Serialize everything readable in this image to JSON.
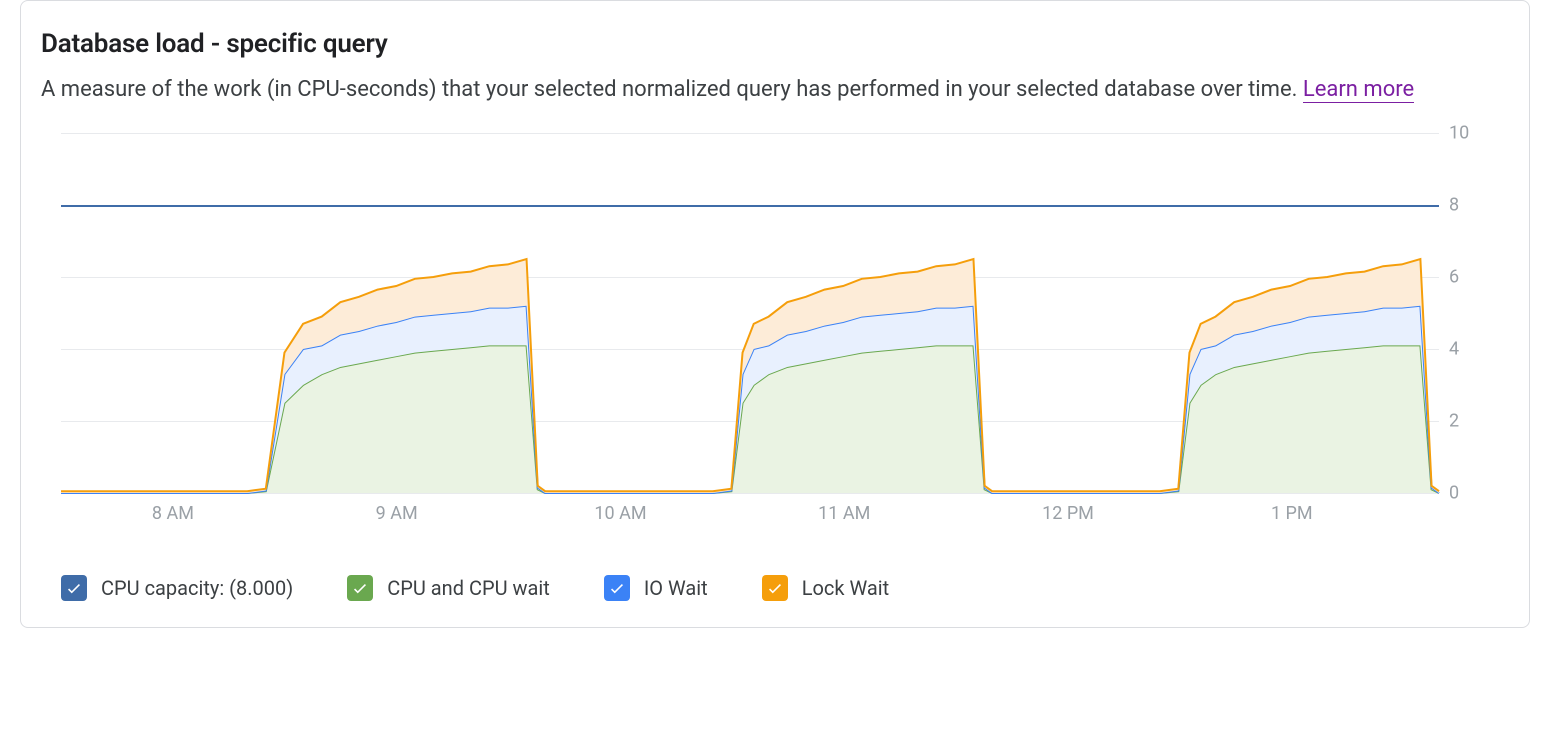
{
  "title": "Database load - specific query",
  "subtitle": "A measure of the work (in CPU-seconds) that your selected normalized query has performed in your selected database over time. ",
  "learn_more": "Learn more",
  "legend": {
    "cpu_capacity": "CPU capacity: (8.000)",
    "cpu_wait": "CPU and CPU wait",
    "io_wait": "IO Wait",
    "lock_wait": "Lock Wait"
  },
  "colors": {
    "cpu_capacity": "#3f6ca8",
    "cpu_wait": "#6aa84f",
    "io_wait": "#3b82f6",
    "lock_wait": "#f59e0b",
    "cpu_wait_fill": "#eaf3e3",
    "io_wait_fill": "#e8f0fe",
    "lock_wait_fill": "#fdecd8"
  },
  "chart_data": {
    "type": "area",
    "title": "Database load - specific query",
    "xlabel": "",
    "ylabel": "",
    "ylim": [
      0,
      10
    ],
    "y_ticks": [
      0,
      2,
      4,
      6,
      8,
      10
    ],
    "x_ticks": [
      "8 AM",
      "9 AM",
      "10 AM",
      "11 AM",
      "12 PM",
      "1 PM"
    ],
    "x_range_minutes": [
      450,
      820
    ],
    "cpu_capacity_value": 8.0,
    "x_minutes": [
      450,
      460,
      470,
      480,
      490,
      500,
      505,
      510,
      515,
      520,
      525,
      530,
      535,
      540,
      545,
      550,
      555,
      560,
      565,
      570,
      575,
      578,
      580,
      585,
      590,
      600,
      610,
      620,
      625,
      630,
      633,
      636,
      640,
      645,
      650,
      655,
      660,
      665,
      670,
      675,
      680,
      685,
      690,
      695,
      698,
      700,
      705,
      710,
      720,
      730,
      740,
      745,
      750,
      753,
      756,
      760,
      765,
      770,
      775,
      780,
      785,
      790,
      795,
      800,
      805,
      810,
      815,
      818,
      820
    ],
    "series": [
      {
        "name": "CPU and CPU wait",
        "color_key": "cpu_wait",
        "values": [
          0,
          0,
          0,
          0,
          0,
          0,
          0.05,
          2.5,
          3.0,
          3.3,
          3.5,
          3.6,
          3.7,
          3.8,
          3.9,
          3.95,
          4.0,
          4.05,
          4.1,
          4.1,
          4.1,
          0.1,
          0,
          0,
          0,
          0,
          0,
          0,
          0,
          0.05,
          2.5,
          3.0,
          3.3,
          3.5,
          3.6,
          3.7,
          3.8,
          3.9,
          3.95,
          4.0,
          4.05,
          4.1,
          4.1,
          4.1,
          0.1,
          0,
          0,
          0,
          0,
          0,
          0,
          0,
          0.05,
          2.5,
          3.0,
          3.3,
          3.5,
          3.6,
          3.7,
          3.8,
          3.9,
          3.95,
          4.0,
          4.05,
          4.1,
          4.1,
          4.1,
          0.1,
          0
        ]
      },
      {
        "name": "IO Wait",
        "color_key": "io_wait",
        "values": [
          0,
          0,
          0,
          0,
          0,
          0,
          0.02,
          0.8,
          1.0,
          0.8,
          0.9,
          0.9,
          0.95,
          0.95,
          1.0,
          1.0,
          1.0,
          1.0,
          1.05,
          1.05,
          1.1,
          0.05,
          0,
          0,
          0,
          0,
          0,
          0,
          0,
          0.02,
          0.8,
          1.0,
          0.8,
          0.9,
          0.9,
          0.95,
          0.95,
          1.0,
          1.0,
          1.0,
          1.0,
          1.05,
          1.05,
          1.1,
          0.05,
          0,
          0,
          0,
          0,
          0,
          0,
          0,
          0.02,
          0.8,
          1.0,
          0.8,
          0.9,
          0.9,
          0.95,
          0.95,
          1.0,
          1.0,
          1.0,
          1.0,
          1.05,
          1.05,
          1.1,
          0.05,
          0
        ]
      },
      {
        "name": "Lock Wait",
        "color_key": "lock_wait",
        "values": [
          0.05,
          0.05,
          0.05,
          0.05,
          0.05,
          0.05,
          0.05,
          0.6,
          0.7,
          0.8,
          0.9,
          0.95,
          1.0,
          1.0,
          1.05,
          1.05,
          1.1,
          1.1,
          1.15,
          1.2,
          1.3,
          0.05,
          0.05,
          0.05,
          0.05,
          0.05,
          0.05,
          0.05,
          0.05,
          0.05,
          0.6,
          0.7,
          0.8,
          0.9,
          0.95,
          1.0,
          1.0,
          1.05,
          1.05,
          1.1,
          1.1,
          1.15,
          1.2,
          1.3,
          0.05,
          0.05,
          0.05,
          0.05,
          0.05,
          0.05,
          0.05,
          0.05,
          0.05,
          0.6,
          0.7,
          0.8,
          0.9,
          0.95,
          1.0,
          1.0,
          1.05,
          1.05,
          1.1,
          1.1,
          1.15,
          1.2,
          1.3,
          0.05,
          0.05
        ]
      }
    ]
  }
}
